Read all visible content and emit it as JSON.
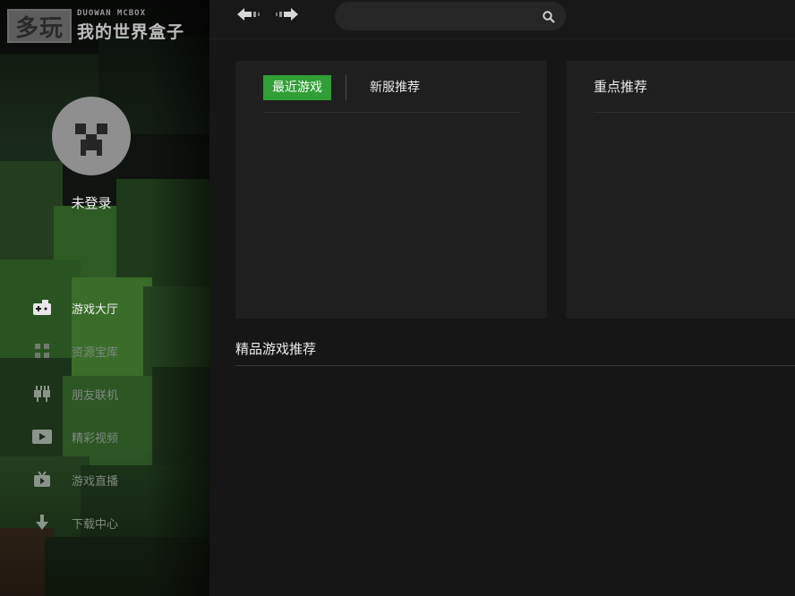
{
  "logo": {
    "badge": "多玩",
    "en": "DUOWAN MCBOX",
    "cn": "我的世界盒子"
  },
  "user": {
    "name": "未登录",
    "avatar_icon": "creeper-icon"
  },
  "nav": [
    {
      "label": "游戏大厅",
      "icon": "gamepad-icon",
      "active": true
    },
    {
      "label": "资源宝库",
      "icon": "grid-icon",
      "active": false
    },
    {
      "label": "朋友联机",
      "icon": "plug-icon",
      "active": false
    },
    {
      "label": "精彩视频",
      "icon": "play-icon",
      "active": false
    },
    {
      "label": "游戏直播",
      "icon": "tv-icon",
      "active": false
    },
    {
      "label": "下载中心",
      "icon": "download-icon",
      "active": false
    }
  ],
  "toolbar": {
    "back_icon": "back-arrow-icon",
    "forward_icon": "forward-arrow-icon",
    "search_placeholder": "",
    "search_icon": "search-icon"
  },
  "panels": {
    "left_tabs": [
      "最近游戏",
      "新服推荐"
    ],
    "active_tab": "最近游戏",
    "right_title": "重点推荐"
  },
  "section": {
    "title": "精品游戏推荐"
  },
  "colors": {
    "accent": "#2f9f36",
    "background": "#161616",
    "panel": "#1f1f1f",
    "sidebar": "#101410"
  }
}
